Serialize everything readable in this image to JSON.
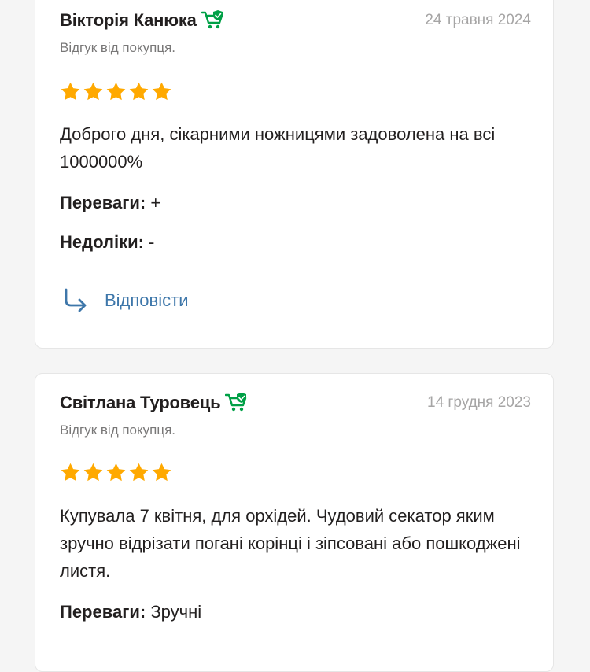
{
  "reviews": [
    {
      "author": "Вікторія Канюка",
      "date": "24 травня 2024",
      "buyer_label": "Відгук від покупця.",
      "rating": 5,
      "text": "Доброго дня, сікарними ножницями задоволена на всі 1000000%",
      "pros_label": "Переваги:",
      "pros_value": " +",
      "cons_label": "Недоліки:",
      "cons_value": " -",
      "reply_label": "Відповісти"
    },
    {
      "author": "Світлана Туровець",
      "date": "14 грудня 2023",
      "buyer_label": "Відгук від покупця.",
      "rating": 5,
      "text": "Купувала 7 квітня, для орхідей. Чудовий секатор яким зручно відрізати погані корінці і зіпсовані або пошкоджені листя.",
      "pros_label": "Переваги:",
      "pros_value": " Зручні"
    }
  ],
  "colors": {
    "star": "#ffa900",
    "verified_icon": "#00a046",
    "reply_link": "#3e77aa",
    "date_text": "#a6a5a5"
  },
  "icons": {
    "verified": "cart-check-icon",
    "star": "star-icon",
    "reply": "reply-arrow-icon"
  }
}
